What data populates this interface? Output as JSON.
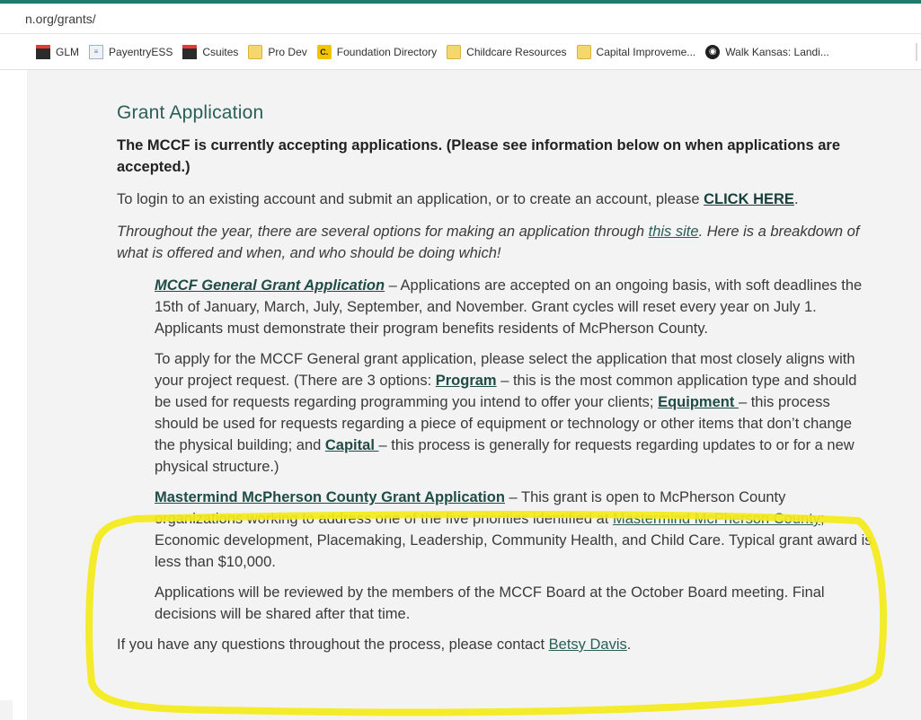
{
  "browser": {
    "url": "n.org/grants/",
    "bookmarks": [
      {
        "label": "GLM",
        "icon": "glm-logo-icon",
        "glyph": ""
      },
      {
        "label": "PayentryESS",
        "icon": "document-icon",
        "glyph": "≡"
      },
      {
        "label": "Csuites",
        "icon": "glm-logo-icon",
        "glyph": ""
      },
      {
        "label": "Pro Dev",
        "icon": "folder-icon",
        "glyph": ""
      },
      {
        "label": "Foundation Directory",
        "icon": "c-logo-icon",
        "glyph": "C."
      },
      {
        "label": "Childcare Resources",
        "icon": "folder-icon",
        "glyph": ""
      },
      {
        "label": "Capital Improveme...",
        "icon": "folder-icon",
        "glyph": ""
      },
      {
        "label": "Walk Kansas: Landi...",
        "icon": "globe-icon",
        "glyph": "◉"
      }
    ]
  },
  "page": {
    "title": "Grant Application",
    "lead": "The MCCF is currently accepting applications. (Please see information below on when applications are accepted.)",
    "login": {
      "before": "To login to an existing account and submit an application, or to create an account, please ",
      "link": "CLICK HERE",
      "after": "."
    },
    "intro": {
      "before": "Throughout the year, there are several options for making an application through ",
      "link": "this site",
      "after": ". Here is a breakdown of what is offered and when, and who should be doing which!"
    },
    "general": {
      "link": "MCCF General Grant Application",
      "text": " – Applications are accepted on an ongoing basis, with soft deadlines the 15th of January, March, July, September, and November. Grant cycles will reset every year on July 1. Applicants must demonstrate their program benefits residents of McPherson County."
    },
    "apply": {
      "t1": "To apply for the MCCF General grant application, please select the application that most closely aligns with your project request. (There are 3 options: ",
      "program": "Program",
      "t2": " – this is the most common application type and should be used for requests regarding programming you intend to offer your clients; ",
      "equipment": "Equipment ",
      "t3": "– this process should be used for requests regarding a piece of equipment or technology or other items that don’t change the physical building; and ",
      "capital": "Capital ",
      "t4": "– this process is generally for requests regarding updates to or for a new physical structure.)"
    },
    "mastermind": {
      "link": "Mastermind McPherson County Grant Application",
      "t1": " – This grant is open to McPherson County organizations working to address one of the five priorities identified at ",
      "link2": "Mastermind McPherson County",
      "t2": "; Economic development, Placemaking, Leadership, Community Health, and Child Care. Typical grant award is less than $10,000."
    },
    "review": "Applications will be reviewed by the members of the MCCF Board at the October Board meeting. Final decisions will be shared after that time.",
    "contact": {
      "before": "If you have any questions throughout the process, please contact ",
      "link": "Betsy Davis",
      "after": "."
    }
  },
  "colors": {
    "accent": "#1f7a6f",
    "heading": "#2b5f57",
    "highlight": "#f4ea1a"
  }
}
